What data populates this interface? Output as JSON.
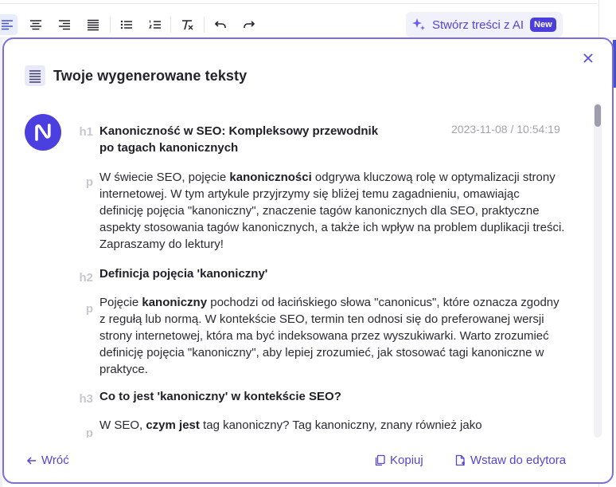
{
  "toolbar": {
    "ai_button_label": "Stwórz treści z AI",
    "ai_badge": "New"
  },
  "modal": {
    "title": "Twoje wygenerowane teksty",
    "timestamp": "2023-11-08 / 10:54:19",
    "blocks": [
      {
        "tag": "h1",
        "lines": [
          "Kanoniczność w SEO: Kompleksowy przewodnik",
          "po tagach kanonicznych"
        ]
      },
      {
        "tag": "p",
        "text_a": "W świecie SEO, pojęcie ",
        "bold": "kanoniczności",
        "text_b": " odgrywa kluczową rolę w optymalizacji strony internetowej. W tym artykule przyjrzymy się bliżej temu zagadnieniu, omawiając definicję pojęcia \"kanoniczny\", znaczenie tagów kanonicznych dla SEO, praktyczne aspekty stosowania tagów kanonicznych, a także ich wpływ na problem duplikacji treści. Zapraszamy do lektury!"
      },
      {
        "tag": "h2",
        "text": "Definicja pojęcia 'kanoniczny'"
      },
      {
        "tag": "p",
        "text_a": "Pojęcie ",
        "bold": "kanoniczny",
        "text_b": " pochodzi od łacińskiego słowa \"canonicus\", które oznacza zgodny z regułą lub normą. W kontekście SEO, termin ten odnosi się do preferowanej wersji strony internetowej, która ma być indeksowana przez wyszukiwarki. Warto zrozumieć definicję pojęcia \"kanoniczny\", aby lepiej zrozumieć, jak stosować tagi kanoniczne w praktyce."
      },
      {
        "tag": "h3",
        "text": "Co to jest 'kanoniczny' w kontekście SEO?"
      },
      {
        "tag": "p",
        "text_a": "W SEO, ",
        "bold": "czym jest",
        "text_b": " tag kanoniczny? Tag kanoniczny, znany również jako"
      }
    ],
    "footer": {
      "back_label": "Wróć",
      "copy_label": "Kopiuj",
      "insert_label": "Wstaw do edytora"
    }
  },
  "colors": {
    "accent": "#5446cf",
    "border": "#7a6ee6",
    "avatar": "#4b3fe0"
  }
}
